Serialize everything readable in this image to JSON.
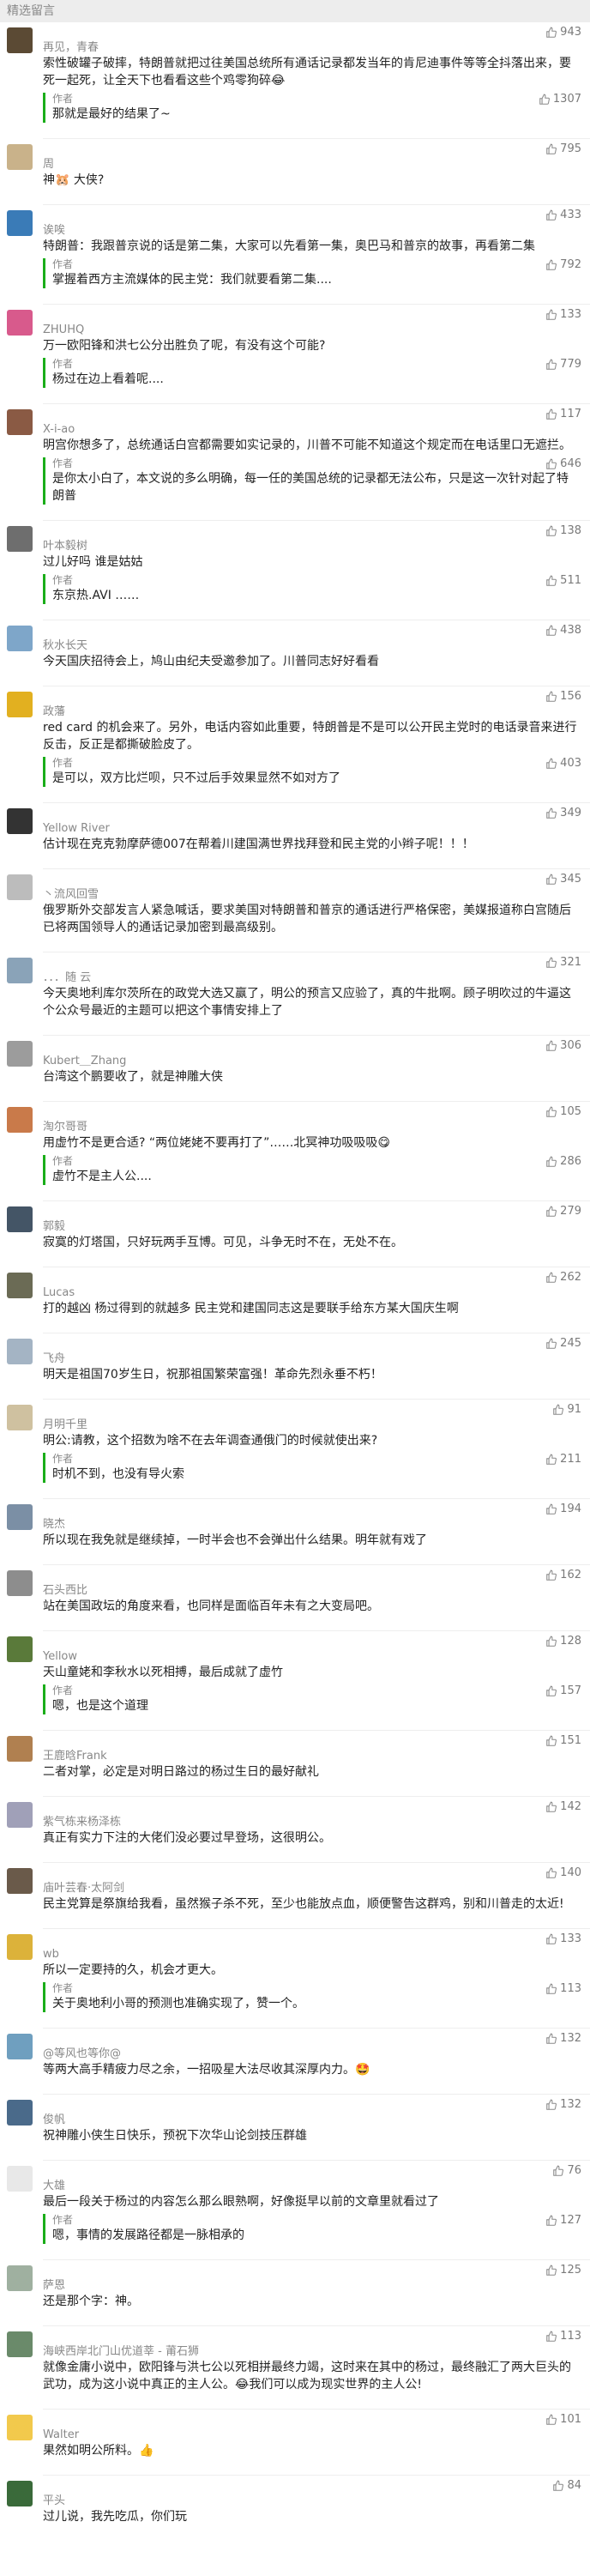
{
  "section_title": "精选留言",
  "colors": {
    "author_bar": "#1aad19",
    "meta": "#888888"
  },
  "comments": [
    {
      "name": "再见，青春",
      "likes": "943",
      "avatar_color": "#5b4a34",
      "text": "索性破罐子破摔，特朗普就把过往美国总统所有通话记录都发当年的肯尼迪事件等等全抖落出来，要死一起死，让全天下也看看这些个鸡零狗碎😂",
      "reply": {
        "label": "作者",
        "text": "那就是最好的结果了~",
        "likes": "1307"
      }
    },
    {
      "name": "周",
      "likes": "795",
      "avatar_color": "#c9b28a",
      "text": "神🐹 大侠?"
    },
    {
      "name": "诶唉",
      "likes": "433",
      "avatar_color": "#3a7bb7",
      "text": "特朗普：我跟普京说的话是第二集，大家可以先看第一集，奥巴马和普京的故事，再看第二集",
      "reply": {
        "label": "作者",
        "text": "掌握着西方主流媒体的民主党：我们就要看第二集....",
        "likes": "792"
      }
    },
    {
      "name": "ZHUHQ",
      "likes": "133",
      "avatar_color": "#d85a8c",
      "text": "万一欧阳锋和洪七公分出胜负了呢，有没有这个可能?",
      "reply": {
        "label": "作者",
        "text": "杨过在边上看着呢....",
        "likes": "779"
      }
    },
    {
      "name": "X-i-ao",
      "likes": "117",
      "avatar_color": "#8a5a44",
      "text": "明宫你想多了，总统通话白宫都需要如实记录的，川普不可能不知道这个规定而在电话里口无遮拦。",
      "reply": {
        "label": "作者",
        "text": "是你太小白了，本文说的多么明确，每一任的美国总统的记录都无法公布，只是这一次针对起了特朗普",
        "likes": "646"
      }
    },
    {
      "name": "叶本毅树",
      "likes": "138",
      "avatar_color": "#6e6e6e",
      "text": "过儿好吗 谁是姑姑",
      "reply": {
        "label": "作者",
        "text": "东京热.AVI ……",
        "likes": "511"
      }
    },
    {
      "name": "秋水长天",
      "likes": "438",
      "avatar_color": "#7ea6c9",
      "text": "今天国庆招待会上，鸠山由纪夫受邀参加了。川普同志好好看看"
    },
    {
      "name": "政藩",
      "likes": "156",
      "avatar_color": "#e2b020",
      "text": "red card 的机会来了。另外，电话内容如此重要，特朗普是不是可以公开民主党时的电话录音来进行反击，反正是都撕破脸皮了。",
      "reply": {
        "label": "作者",
        "text": "是可以，双方比烂呗，只不过后手效果显然不如对方了",
        "likes": "403"
      }
    },
    {
      "name": "Yellow River",
      "likes": "349",
      "avatar_color": "#333333",
      "text": "估计现在克克勃摩萨德007在帮着川建国满世界找拜登和民主党的小辫子呢！！！"
    },
    {
      "name": "丶流风回雪",
      "likes": "345",
      "avatar_color": "#bcbcbc",
      "text": "俄罗斯外交部发言人紧急喊话，要求美国对特朗普和普京的通话进行严格保密，美媒报道称白宫随后已将两国领导人的通话记录加密到最高级别。"
    },
    {
      "name": "．．．随 云",
      "likes": "321",
      "avatar_color": "#8aa3b8",
      "text": "今天奥地利库尔茨所在的政党大选又赢了，明公的预言又应验了，真的牛批啊。顾子明吹过的牛逼这个公众号最近的主题可以把这个事情安排上了"
    },
    {
      "name": "Kubert＿Zhang",
      "likes": "306",
      "avatar_color": "#9c9c9c",
      "text": "台湾这个鹏要收了，就是神雕大侠"
    },
    {
      "name": "淘尔哥哥",
      "likes": "105",
      "avatar_color": "#c97a4a",
      "text": "用虚竹不是更合适? “两位姥姥不要再打了”……北冥神功吸吸吸😋",
      "reply": {
        "label": "作者",
        "text": "虚竹不是主人公....",
        "likes": "286"
      }
    },
    {
      "name": "郭毅",
      "likes": "279",
      "avatar_color": "#445566",
      "text": "寂寞的灯塔国，只好玩两手互博。可见，斗争无时不在，无处不在。"
    },
    {
      "name": "Lucas",
      "likes": "262",
      "avatar_color": "#6b6b55",
      "text": "打的越凶 杨过得到的就越多 民主党和建国同志这是要联手给东方某大国庆生啊"
    },
    {
      "name": "飞舟",
      "likes": "245",
      "avatar_color": "#a4b4c4",
      "text": "明天是祖国70岁生日，祝那祖国繁荣富强！革命先烈永垂不朽！"
    },
    {
      "name": "月明千里",
      "likes": "91",
      "avatar_color": "#cfc1a0",
      "text": "明公:请教，这个招数为啥不在去年调查通俄门的时候就使出来?",
      "reply": {
        "label": "作者",
        "text": "时机不到，也没有导火索",
        "likes": "211"
      }
    },
    {
      "name": "晓杰",
      "likes": "194",
      "avatar_color": "#7b8fa5",
      "text": "所以现在我免就是继续掉，一时半会也不会弹出什么结果。明年就有戏了"
    },
    {
      "name": "石头西比",
      "likes": "162",
      "avatar_color": "#8d8d8d",
      "text": "站在美国政坛的角度来看，也同样是面临百年未有之大变局吧。"
    },
    {
      "name": "Yellow",
      "likes": "128",
      "avatar_color": "#5a7a3a",
      "text": "天山童姥和李秋水以死相搏，最后成就了虚竹",
      "reply": {
        "label": "作者",
        "text": "嗯，也是这个道理",
        "likes": "157"
      }
    },
    {
      "name": "王鹿晗Frank",
      "likes": "151",
      "avatar_color": "#b08050",
      "text": "二者对掌，必定是对明日路过的杨过生日的最好献礼"
    },
    {
      "name": "紫气栋来杨泽栋",
      "likes": "142",
      "avatar_color": "#a0a0b8",
      "text": "真正有实力下注的大佬们没必要过早登场，这很明公。"
    },
    {
      "name": "庙叶芸春·太阿剑",
      "likes": "140",
      "avatar_color": "#6a5a4a",
      "text": "民主党算是祭旗给我看，虽然猴子杀不死，至少也能放点血，顺便警告这群鸡，别和川普走的太近!"
    },
    {
      "name": "wb",
      "likes": "133",
      "avatar_color": "#dcb23a",
      "text": "所以一定要持的久，机会才更大。",
      "reply": {
        "label": "作者",
        "text": "关于奥地利小哥的预测也准确实现了，赞一个。",
        "likes": "113"
      }
    },
    {
      "name": "@等风也等你@",
      "likes": "132",
      "avatar_color": "#6f9fbf",
      "text": "等两大高手精疲力尽之余，一招吸星大法尽收其深厚内力。🤩"
    },
    {
      "name": "俊帆",
      "likes": "132",
      "avatar_color": "#4a6a8a",
      "text": "祝神雕小侠生日快乐，预祝下次华山论剑技压群雄"
    },
    {
      "name": "大雄",
      "likes": "76",
      "avatar_color": "#e8e8e8",
      "text": "最后一段关于杨过的内容怎么那么眼熟啊，好像挺早以前的文章里就看过了",
      "reply": {
        "label": "作者",
        "text": "嗯，事情的发展路径都是一脉相承的",
        "likes": "127"
      }
    },
    {
      "name": "萨恩",
      "likes": "125",
      "avatar_color": "#9fb0a0",
      "text": "还是那个字：神。"
    },
    {
      "name": "海峡西岸北门山优道莘 - 莆石狮",
      "likes": "113",
      "avatar_color": "#6a8a6a",
      "text": "就像金庸小说中，欧阳锋与洪七公以死相拼最终力竭，这时来在其中的杨过，最终融汇了两大巨头的武功，成为这小说中真正的主人公。😂我们可以成为现实世界的主人公!"
    },
    {
      "name": "Walter",
      "likes": "101",
      "avatar_color": "#f2c94c",
      "text": "果然如明公所料。👍"
    },
    {
      "name": "平头",
      "likes": "84",
      "avatar_color": "#3a6a3a",
      "text": "过儿说，我先吃瓜，你们玩"
    }
  ]
}
